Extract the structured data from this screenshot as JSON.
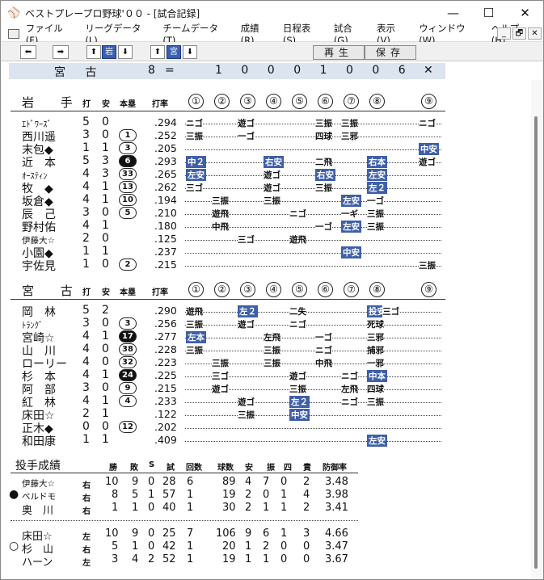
{
  "window": {
    "title": "ベストプレープロ野球'００ - [試合記録]",
    "minimize": "—",
    "maximize": "☐",
    "close": "✕"
  },
  "menu": [
    "ファイル(F)",
    "リーグデータ(L)",
    "チームデータ(T)",
    "成績(R)",
    "日程表(S)",
    "試合(G)",
    "表示(V)",
    "ウィンドウ(W)",
    "ヘルプ(H)"
  ],
  "mdi": {
    "min": "_",
    "restore": "🗗",
    "close": "✕"
  },
  "toolbar": {
    "team1": "岩",
    "team2": "宮",
    "play": "再生",
    "save": "保存"
  },
  "score": {
    "team": "宮 古",
    "total": "8",
    "eq": "=",
    "innings": [
      "1",
      "0",
      "0",
      "0",
      "1",
      "0",
      "0",
      "6"
    ],
    "x": "✕"
  },
  "col_headers": {
    "ab": "打",
    "h": "安",
    "hr": "本塁",
    "avg": "打率"
  },
  "innings_label": [
    "①",
    "②",
    "③",
    "④",
    "⑤",
    "⑥",
    "⑦",
    "⑧",
    "⑨"
  ],
  "team1": {
    "name": "岩 手",
    "players": [
      {
        "name": "ｴﾄﾞﾜｰｽﾞ",
        "small": true,
        "ab": "5",
        "h": "0",
        "hr": "",
        "avg": ".294"
      },
      {
        "name": "西川遥",
        "ab": "3",
        "h": "0",
        "hr": "1",
        "avg": ".252"
      },
      {
        "name": "末包◆",
        "ab": "1",
        "h": "1",
        "hr": "3",
        "avg": ".205"
      },
      {
        "name": "近　本",
        "ab": "5",
        "h": "3",
        "hr": "6",
        "hrblack": true,
        "avg": ".293"
      },
      {
        "name": "ｵｰｽﾃｨﾝ",
        "small": true,
        "ab": "4",
        "h": "3",
        "hr": "33",
        "avg": ".265"
      },
      {
        "name": "牧　◆",
        "ab": "4",
        "h": "1",
        "hr": "13",
        "avg": ".262"
      },
      {
        "name": "坂倉◆",
        "ab": "4",
        "h": "1",
        "hr": "10",
        "avg": ".194"
      },
      {
        "name": "辰　己",
        "ab": "3",
        "h": "0",
        "hr": "5",
        "avg": ".210"
      },
      {
        "name": "野村佑",
        "ab": "4",
        "h": "1",
        "hr": "",
        "avg": ".180"
      },
      {
        "name": "伊藤大☆",
        "small": true,
        "ab": "2",
        "h": "0",
        "hr": "",
        "avg": ".125"
      },
      {
        "name": "小園◆",
        "ab": "1",
        "h": "1",
        "hr": "",
        "avg": ".237"
      },
      {
        "name": "宇佐見",
        "ab": "1",
        "h": "0",
        "hr": "2",
        "avg": ".215"
      }
    ],
    "plays": [
      [
        [
          1,
          "ニゴ",
          false
        ],
        [
          3,
          "遊ゴ",
          false
        ],
        [
          6,
          "三振",
          false
        ],
        [
          7,
          "三振",
          false
        ],
        [
          9,
          "ニゴ",
          false
        ]
      ],
      [
        [
          1,
          "三振",
          false
        ],
        [
          3,
          "一ゴ",
          false
        ],
        [
          6,
          "四球",
          false
        ],
        [
          7,
          "三邪",
          false
        ]
      ],
      [
        [
          9,
          "中安",
          true
        ]
      ],
      [
        [
          1,
          "中２",
          true
        ],
        [
          4,
          "右安",
          true
        ],
        [
          6,
          "二飛",
          false
        ],
        [
          8,
          "右本",
          true
        ],
        [
          9,
          "遊ゴ",
          false
        ]
      ],
      [
        [
          1,
          "左安",
          true
        ],
        [
          4,
          "遊ゴ",
          false
        ],
        [
          6,
          "右安",
          true
        ],
        [
          8,
          "左安",
          true
        ]
      ],
      [
        [
          1,
          "三ゴ",
          false
        ],
        [
          4,
          "遊ゴ",
          false
        ],
        [
          6,
          "三振",
          false
        ],
        [
          8,
          "左２",
          true
        ]
      ],
      [
        [
          2,
          "三振",
          false
        ],
        [
          4,
          "三振",
          false
        ],
        [
          7,
          "左安",
          true
        ],
        [
          8,
          "一ゴ",
          false
        ]
      ],
      [
        [
          2,
          "遊飛",
          false
        ],
        [
          5,
          "ニゴ",
          false
        ],
        [
          7,
          "一ギ",
          false
        ],
        [
          8,
          "三振",
          false
        ]
      ],
      [
        [
          2,
          "中飛",
          false
        ],
        [
          6,
          "一ゴ",
          false
        ],
        [
          7,
          "左安",
          true
        ],
        [
          8,
          "三振",
          false
        ]
      ],
      [
        [
          3,
          "三ゴ",
          false
        ],
        [
          5,
          "遊飛",
          false
        ]
      ],
      [
        [
          7,
          "中安",
          true
        ]
      ],
      [
        [
          9,
          "三振",
          false
        ]
      ]
    ]
  },
  "team2": {
    "name": "宮 古",
    "players": [
      {
        "name": "岡　林",
        "ab": "5",
        "h": "2",
        "hr": "",
        "avg": ".290"
      },
      {
        "name": "ﾄﾗﾝｸﾞ",
        "small": true,
        "ab": "3",
        "h": "0",
        "hr": "3",
        "avg": ".256"
      },
      {
        "name": "宮崎☆",
        "ab": "4",
        "h": "1",
        "hr": "17",
        "hrblack": true,
        "avg": ".277"
      },
      {
        "name": "山　川",
        "ab": "4",
        "h": "0",
        "hr": "38",
        "avg": ".228"
      },
      {
        "name": "ローリー",
        "ab": "4",
        "h": "0",
        "hr": "32",
        "avg": ".223"
      },
      {
        "name": "杉　本",
        "ab": "4",
        "h": "1",
        "hr": "24",
        "hrblack": true,
        "avg": ".225"
      },
      {
        "name": "阿　部",
        "ab": "3",
        "h": "0",
        "hr": "9",
        "avg": ".215"
      },
      {
        "name": "紅　林",
        "ab": "4",
        "h": "1",
        "hr": "4",
        "avg": ".233"
      },
      {
        "name": "床田☆",
        "ab": "2",
        "h": "1",
        "hr": "",
        "avg": ".122"
      },
      {
        "name": "正木◆",
        "ab": "0",
        "h": "0",
        "hr": "12",
        "avg": ".202"
      },
      {
        "name": "和田康",
        "ab": "1",
        "h": "1",
        "hr": "",
        "avg": ".409"
      }
    ],
    "plays": [
      [
        [
          1,
          "遊飛",
          false
        ],
        [
          3,
          "左２",
          true
        ],
        [
          5,
          "二失",
          false
        ],
        [
          8,
          "投安",
          true
        ],
        [
          8.6,
          "三ゴ",
          false
        ]
      ],
      [
        [
          1,
          "三振",
          false
        ],
        [
          3,
          "遊ゴ",
          false
        ],
        [
          5,
          "ニゴ",
          false
        ],
        [
          8,
          "死球",
          false
        ]
      ],
      [
        [
          1,
          "左本",
          true
        ],
        [
          4,
          "左飛",
          false
        ],
        [
          6,
          "一ゴ",
          false
        ],
        [
          8,
          "三邪",
          false
        ]
      ],
      [
        [
          1,
          "三振",
          false
        ],
        [
          4,
          "三振",
          false
        ],
        [
          6,
          "ニゴ",
          false
        ],
        [
          8,
          "捕邪",
          false
        ]
      ],
      [
        [
          2,
          "三振",
          false
        ],
        [
          4,
          "三振",
          false
        ],
        [
          6,
          "中飛",
          false
        ],
        [
          8,
          "一邪",
          false
        ]
      ],
      [
        [
          2,
          "三ゴ",
          false
        ],
        [
          5,
          "遊ゴ",
          false
        ],
        [
          7,
          "ニゴ",
          false
        ],
        [
          8,
          "中本",
          true
        ]
      ],
      [
        [
          2,
          "遊ゴ",
          false
        ],
        [
          5,
          "三振",
          false
        ],
        [
          7,
          "左飛",
          false
        ],
        [
          8,
          "四球",
          false
        ]
      ],
      [
        [
          3,
          "遊ゴ",
          false
        ],
        [
          5,
          "左２",
          true
        ],
        [
          7,
          "ニゴ",
          false
        ],
        [
          8,
          "三振",
          false
        ]
      ],
      [
        [
          3,
          "三振",
          false
        ],
        [
          5,
          "中安",
          true
        ]
      ],
      [],
      [
        [
          8,
          "左安",
          true
        ]
      ]
    ]
  },
  "pitching": {
    "title": "投手成績",
    "headers": [
      "勝",
      "敗",
      "S",
      "試",
      "回数",
      "球数",
      "安",
      "振",
      "四",
      "責",
      "防御率"
    ],
    "team1": [
      {
        "mark": "",
        "name": "伊藤大☆",
        "small": true,
        "hand": "右",
        "vals": [
          "10",
          "9",
          "0",
          "28",
          "6",
          "89",
          "4",
          "7",
          "0",
          "2",
          "3.48"
        ]
      },
      {
        "mark": "●",
        "name": "ペルドモ",
        "small": true,
        "hand": "右",
        "vals": [
          "8",
          "5",
          "1",
          "57",
          "1",
          "19",
          "2",
          "0",
          "1",
          "4",
          "3.98"
        ]
      },
      {
        "mark": "",
        "name": "奥　川",
        "hand": "右",
        "vals": [
          "1",
          "1",
          "0",
          "40",
          "1",
          "30",
          "2",
          "1",
          "1",
          "2",
          "3.41"
        ]
      }
    ],
    "team2": [
      {
        "mark": "",
        "name": "床田☆",
        "hand": "左",
        "vals": [
          "10",
          "9",
          "0",
          "25",
          "7",
          "106",
          "9",
          "6",
          "1",
          "3",
          "4.66"
        ]
      },
      {
        "mark": "○",
        "name": "杉　山",
        "hand": "右",
        "vals": [
          "5",
          "1",
          "0",
          "42",
          "1",
          "20",
          "1",
          "2",
          "0",
          "0",
          "3.47"
        ]
      },
      {
        "mark": "",
        "name": "ハーン",
        "hand": "左",
        "vals": [
          "3",
          "4",
          "2",
          "52",
          "1",
          "19",
          "1",
          "1",
          "0",
          "0",
          "3.67"
        ]
      }
    ]
  }
}
